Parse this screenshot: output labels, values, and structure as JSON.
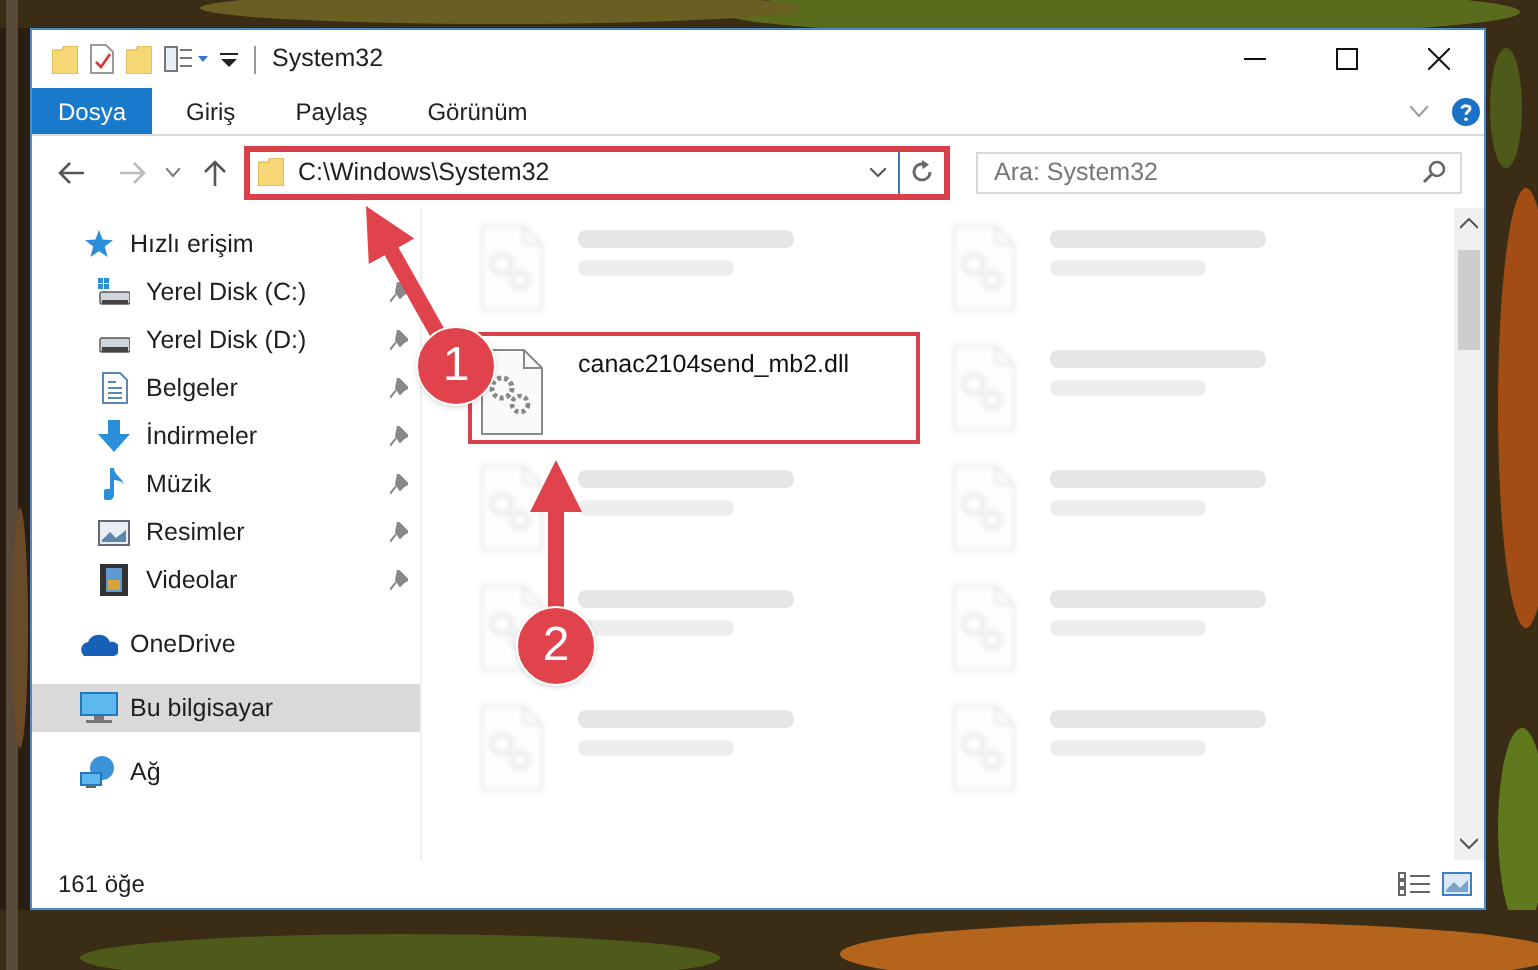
{
  "window": {
    "title": "System32"
  },
  "ribbon_tabs": [
    {
      "label": "Dosya",
      "selected": true
    },
    {
      "label": "Giriş",
      "selected": false
    },
    {
      "label": "Paylaş",
      "selected": false
    },
    {
      "label": "Görünüm",
      "selected": false
    }
  ],
  "address": {
    "path": "C:\\Windows\\System32",
    "highlighted": true
  },
  "search": {
    "placeholder": "Ara: System32"
  },
  "nav": [
    {
      "label": "Hızlı erişim",
      "kind": "star",
      "selected": false,
      "children": [
        {
          "label": "Yerel Disk (C:)",
          "kind": "drive-c",
          "pinned": true
        },
        {
          "label": "Yerel Disk (D:)",
          "kind": "drive",
          "pinned": true
        },
        {
          "label": "Belgeler",
          "kind": "docs",
          "pinned": true
        },
        {
          "label": "İndirmeler",
          "kind": "download",
          "pinned": true
        },
        {
          "label": "Müzik",
          "kind": "music",
          "pinned": true
        },
        {
          "label": "Resimler",
          "kind": "pictures",
          "pinned": true
        },
        {
          "label": "Videolar",
          "kind": "videos",
          "pinned": true
        }
      ]
    },
    {
      "label": "OneDrive",
      "kind": "cloud",
      "selected": false
    },
    {
      "label": "Bu bilgisayar",
      "kind": "pc",
      "selected": true
    },
    {
      "label": "Ağ",
      "kind": "network",
      "selected": false
    }
  ],
  "files": [
    {
      "blurred": true,
      "highlighted": false
    },
    {
      "blurred": true,
      "highlighted": false
    },
    {
      "name": "canac2104send_mb2.dll",
      "blurred": false,
      "highlighted": true
    },
    {
      "blurred": true,
      "highlighted": false
    },
    {
      "blurred": true,
      "highlighted": false
    },
    {
      "blurred": true,
      "highlighted": false
    },
    {
      "blurred": true,
      "highlighted": false
    },
    {
      "blurred": true,
      "highlighted": false
    },
    {
      "blurred": true,
      "highlighted": false
    },
    {
      "blurred": true,
      "highlighted": false
    }
  ],
  "status_bar": {
    "count": "161 öğe"
  },
  "callouts": [
    {
      "number": "1"
    },
    {
      "number": "2"
    }
  ]
}
